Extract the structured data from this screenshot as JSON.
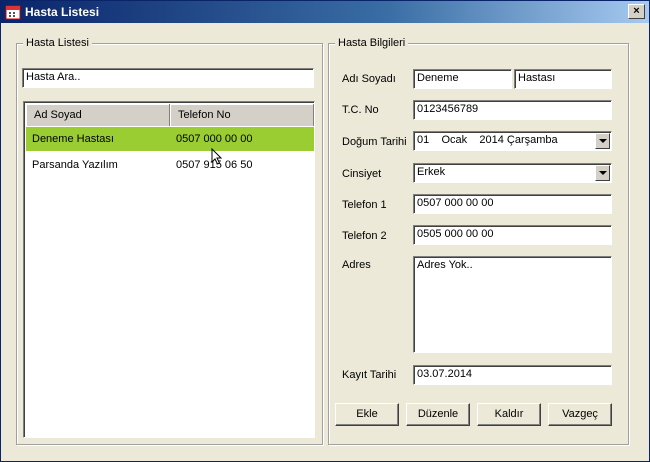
{
  "window": {
    "title": "Hasta Listesi",
    "close_glyph": "×"
  },
  "left_panel": {
    "group_title": "Hasta Listesi",
    "search_value": "Hasta Ara..",
    "columns": [
      "Ad Soyad",
      "Telefon No"
    ],
    "rows": [
      {
        "name": "Deneme Hastası",
        "phone": "0507 000 00 00",
        "selected": true
      },
      {
        "name": "Parsanda Yazılım",
        "phone": "0507 915 06 50",
        "selected": false
      }
    ],
    "selected_color": "#9acd32"
  },
  "right_panel": {
    "group_title": "Hasta Bilgileri",
    "labels": {
      "name": "Adı Soyadı",
      "tc": "T.C. No",
      "birth": "Doğum Tarihi",
      "gender": "Cinsiyet",
      "phone1": "Telefon 1",
      "phone2": "Telefon 2",
      "address": "Adres",
      "registered": "Kayıt Tarihi"
    },
    "values": {
      "first_name": "Deneme",
      "last_name": "Hastası",
      "tc": "0123456789",
      "birth": "01    Ocak    2014 Çarşamba",
      "gender": "Erkek",
      "phone1": "0507 000 00 00",
      "phone2": "0505 000 00 00",
      "address": "Adres Yok..",
      "registered": "03.07.2014"
    },
    "buttons": {
      "add": "Ekle",
      "edit": "Düzenle",
      "delete": "Kaldır",
      "cancel": "Vazgeç"
    }
  },
  "icons": {
    "title_icon": "calendar-icon",
    "cursor": "mouse-pointer-icon"
  }
}
